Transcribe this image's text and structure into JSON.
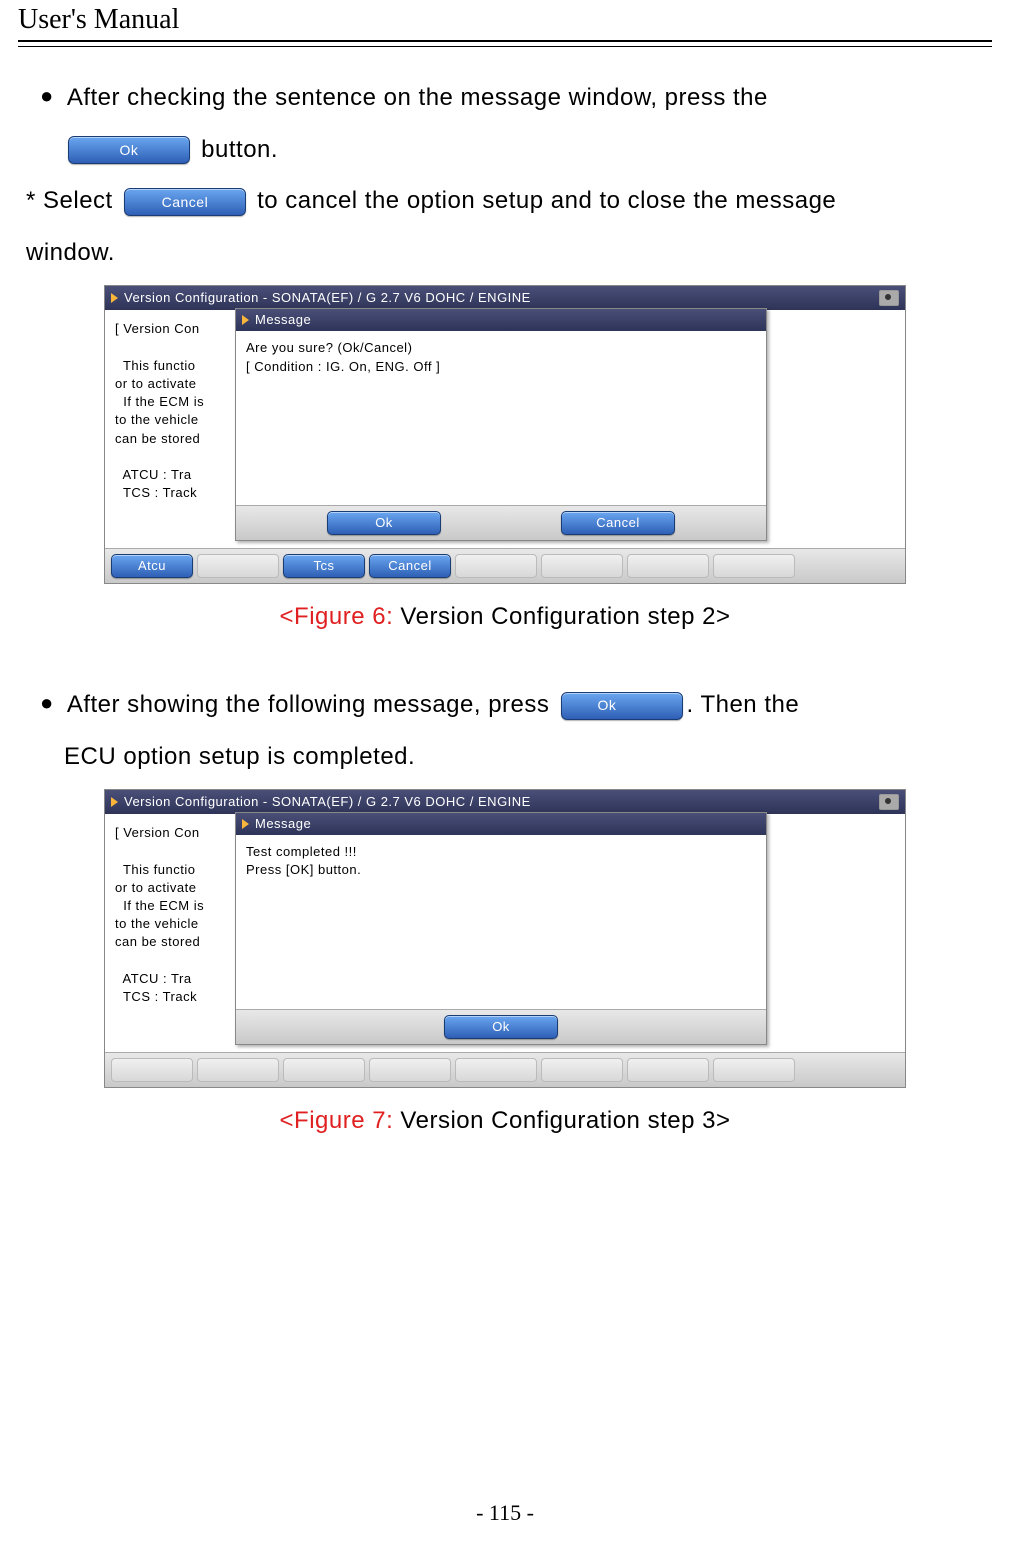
{
  "header": {
    "title": "User's Manual"
  },
  "page_number": "- 115 -",
  "text": {
    "bullet1_a": "After checking the sentence on the message window, press the",
    "bullet1_b": " button.",
    "star_a": "* Select ",
    "star_b": " to cancel the option setup and to close the message",
    "star_c": "window.",
    "bullet2_a": "After showing the following message, press ",
    "bullet2_b": ". Then the",
    "bullet2_c": "ECU option setup is completed."
  },
  "inline_buttons": {
    "ok": "Ok",
    "cancel": "Cancel"
  },
  "fig6": {
    "title": "Version Configuration - SONATA(EF) / G 2.7 V6 DOHC / ENGINE",
    "bg_text": "[ Version Con\n\n  This functio\nor to activate\n  If the ECM is\nto the vehicle\ncan be stored\n\n  ATCU : Tra\n  TCS : Track",
    "msg_title": "Message",
    "msg_body": "Are you sure? (Ok/Cancel)\n[ Condition : IG. On, ENG. Off ]",
    "footer_ok": "Ok",
    "footer_cancel": "Cancel",
    "bottom_atcu": "Atcu",
    "bottom_tcs": "Tcs",
    "bottom_cancel": "Cancel",
    "caption_red": "<Figure 6:",
    "caption_rest": " Version Configuration step 2>"
  },
  "fig7": {
    "title": "Version Configuration - SONATA(EF) / G 2.7 V6 DOHC / ENGINE",
    "bg_text": "[ Version Con\n\n  This functio\nor to activate\n  If the ECM is\nto the vehicle\ncan be stored\n\n  ATCU : Tra\n  TCS : Track",
    "msg_title": "Message",
    "msg_body": "Test completed !!!\nPress [OK] button.",
    "footer_ok": "Ok",
    "caption_red": "<Figure 7:",
    "caption_rest": " Version Configuration step 3>"
  }
}
